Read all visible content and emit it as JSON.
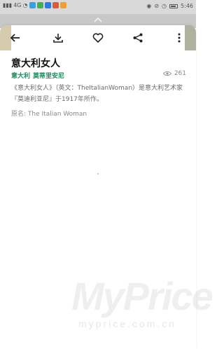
{
  "status_bar": {
    "time": "5:46",
    "signal_text": "4G",
    "battery_icon": "battery-icon",
    "app_icon_colors": [
      "#3aa0e0",
      "#3fb34f",
      "#2e7be0",
      "#e05a3a",
      "#f0a030"
    ]
  },
  "toolbar": {
    "back_icon": "back-arrow-icon",
    "download_icon": "download-icon",
    "favorite_icon": "heart-icon",
    "share_icon": "share-icon",
    "more_icon": "more-vertical-icon"
  },
  "artwork": {
    "title": "意大利女人",
    "country": "意大利",
    "artist": "莫蒂里安尼",
    "view_count": "261",
    "description": "《意大利女人》（英文：TheItalianWoman）是意大利艺术家『莫迪利亚尼』于1917年所作。",
    "original_name": "原名: The Italian Woman"
  },
  "watermark": {
    "brand": "MyPrice",
    "domain": "myprice.com.cn"
  },
  "colors": {
    "accent_green": "#1f8e60"
  }
}
